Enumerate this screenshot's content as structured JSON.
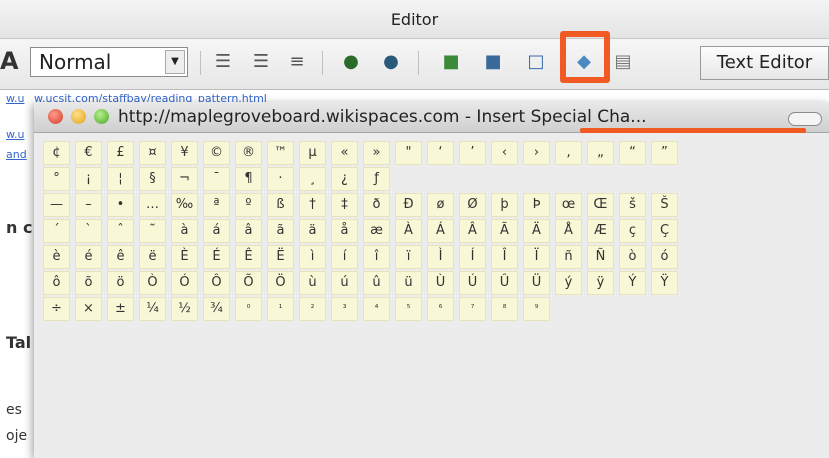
{
  "editor": {
    "title": "Editor",
    "bold_glyph": "A",
    "format_select": {
      "value": "Normal"
    },
    "text_editor_button": "Text Editor"
  },
  "background": {
    "link_url": "w.ucsit.com/staffbay/reading_pattern.html",
    "left_fragments": [
      "w.u",
      "w.u",
      "and",
      "n c",
      "Tal",
      "es",
      "oje"
    ]
  },
  "dialog": {
    "title": "http://maplegroveboard.wikispaces.com - Insert Special Cha...",
    "highlight_color": "#f15a22",
    "char_rows": [
      [
        "¢",
        "€",
        "£",
        "¤",
        "¥",
        "©",
        "®",
        "™",
        "µ",
        "«",
        "»",
        "\"",
        "‘",
        "’",
        "‹",
        "›",
        "‚",
        "„",
        "“",
        "”"
      ],
      [
        "°",
        "¡",
        "¦",
        "§",
        "¬",
        "¯",
        "¶",
        "·",
        "¸",
        "¿",
        "ƒ"
      ],
      [
        "—",
        "–",
        "•",
        "…",
        "‰",
        "ª",
        "º",
        "ß",
        "†",
        "‡",
        "ð",
        "Ð",
        "ø",
        "Ø",
        "þ",
        "Þ",
        "œ",
        "Œ",
        "š",
        "Š"
      ],
      [
        "´",
        "`",
        "ˆ",
        "˜",
        "à",
        "á",
        "â",
        "ã",
        "ä",
        "å",
        "æ",
        "À",
        "Á",
        "Â",
        "Ã",
        "Ä",
        "Å",
        "Æ",
        "ç",
        "Ç"
      ],
      [
        "è",
        "é",
        "ê",
        "ë",
        "È",
        "É",
        "Ê",
        "Ë",
        "ì",
        "í",
        "î",
        "ï",
        "Ì",
        "Í",
        "Î",
        "Ï",
        "ñ",
        "Ñ",
        "ò",
        "ó"
      ],
      [
        "ô",
        "õ",
        "ö",
        "Ò",
        "Ó",
        "Ô",
        "Õ",
        "Ö",
        "ù",
        "ú",
        "û",
        "ü",
        "Ù",
        "Ú",
        "Û",
        "Ü",
        "ý",
        "ÿ",
        "Ý",
        "Ÿ"
      ],
      [
        "÷",
        "×",
        "±",
        "¼",
        "½",
        "¾",
        "⁰",
        "¹",
        "²",
        "³",
        "⁴",
        "⁵",
        "⁶",
        "⁷",
        "⁸",
        "⁹"
      ]
    ]
  }
}
